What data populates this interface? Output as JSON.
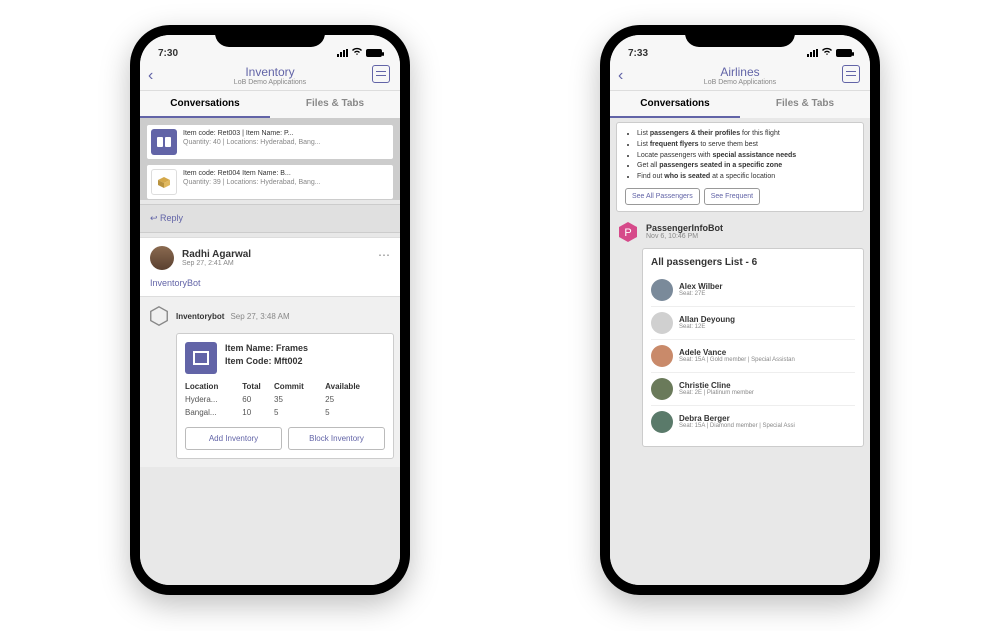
{
  "left": {
    "status_time": "7:30",
    "header": {
      "title": "Inventory",
      "subtitle": "LoB Demo Applications"
    },
    "tabs": {
      "t1": "Conversations",
      "t2": "Files & Tabs"
    },
    "items": [
      {
        "line1": "Item code: Ret003  |  Item Name: P...",
        "line2": "Quantity: 40 | Locations: Hyderabad, Bang..."
      },
      {
        "line1": "Item code: Ret004    Item Name: B...",
        "line2": "Quantity: 39 | Locations: Hyderabad, Bang..."
      }
    ],
    "reply_label": "Reply",
    "user": {
      "name": "Radhi Agarwal",
      "time": "Sep 27, 2:41 AM",
      "mention": "InventoryBot"
    },
    "bot": {
      "name": "Inventorybot",
      "time": "Sep 27, 3:48 AM"
    },
    "card": {
      "title1": "Item Name: Frames",
      "title2": "Item Code: Mft002",
      "headers": {
        "c1": "Location",
        "c2": "Total",
        "c3": "Commit",
        "c4": "Available"
      },
      "rows": [
        {
          "c1": "Hydera...",
          "c2": "60",
          "c3": "35",
          "c4": "25"
        },
        {
          "c1": "Bangal...",
          "c2": "10",
          "c3": "5",
          "c4": "5"
        }
      ],
      "btn1": "Add Inventory",
      "btn2": "Block Inventory"
    }
  },
  "right": {
    "status_time": "7:33",
    "header": {
      "title": "Airlines",
      "subtitle": "LoB Demo Applications"
    },
    "tabs": {
      "t1": "Conversations",
      "t2": "Files & Tabs"
    },
    "bullets": [
      {
        "pre": "List ",
        "b": "passengers & their profiles",
        "post": " for this flight"
      },
      {
        "pre": "List ",
        "b": "frequent flyers",
        "post": " to serve them best"
      },
      {
        "pre": "Locate passengers with ",
        "b": "special assistance needs",
        "post": ""
      },
      {
        "pre": "Get all ",
        "b": "passengers seated in a specific zone",
        "post": ""
      },
      {
        "pre": "Find out ",
        "b": "who is seated",
        "post": " at a specific location"
      }
    ],
    "chips": {
      "c1": "See All Passengers",
      "c2": "See Frequent"
    },
    "bot": {
      "initial": "P",
      "name": "PassengerInfoBot",
      "time": "Nov 6, 10:46 PM"
    },
    "list_title": "All passengers List - 6",
    "passengers": [
      {
        "name": "Alex Wilber",
        "det": "Seat: 27E"
      },
      {
        "name": "Allan Deyoung",
        "det": "Seat: 12E"
      },
      {
        "name": "Adele Vance",
        "det": "Seat: 15A | Gold member | Special Assistan"
      },
      {
        "name": "Christie Cline",
        "det": "Seat: 2E | Platinum member"
      },
      {
        "name": "Debra Berger",
        "det": "Seat: 15A | Diamond member | Special Assi"
      }
    ]
  }
}
